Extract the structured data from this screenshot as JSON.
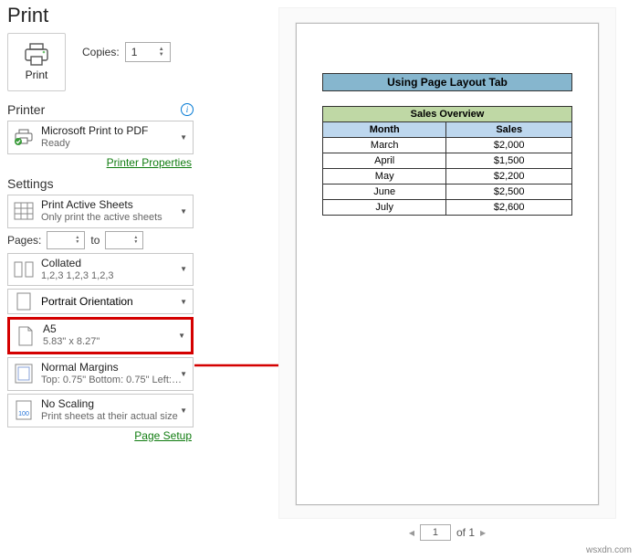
{
  "header": {
    "title": "Print"
  },
  "printButton": {
    "label": "Print"
  },
  "copies": {
    "label": "Copies:",
    "value": "1"
  },
  "printer": {
    "heading": "Printer",
    "name": "Microsoft Print to PDF",
    "status": "Ready",
    "propsLink": "Printer Properties"
  },
  "settings": {
    "heading": "Settings",
    "active": {
      "primary": "Print Active Sheets",
      "secondary": "Only print the active sheets"
    },
    "pagesLabel": "Pages:",
    "toLabel": "to",
    "collated": {
      "primary": "Collated",
      "secondary": "1,2,3   1,2,3   1,2,3"
    },
    "orientation": {
      "primary": "Portrait Orientation"
    },
    "paper": {
      "primary": "A5",
      "secondary": "5.83\" x 8.27\""
    },
    "margins": {
      "primary": "Normal Margins",
      "secondary": "Top: 0.75\" Bottom: 0.75\" Left:…"
    },
    "scaling": {
      "primary": "No Scaling",
      "secondary": "Print sheets at their actual size"
    },
    "pageSetupLink": "Page Setup"
  },
  "preview": {
    "title": "Using Page Layout Tab",
    "tableTitle": "Sales Overview",
    "colMonth": "Month",
    "colSales": "Sales",
    "rows": [
      {
        "month": "March",
        "sales": "$2,000"
      },
      {
        "month": "April",
        "sales": "$1,500"
      },
      {
        "month": "May",
        "sales": "$2,200"
      },
      {
        "month": "June",
        "sales": "$2,500"
      },
      {
        "month": "July",
        "sales": "$2,600"
      }
    ]
  },
  "pager": {
    "current": "1",
    "ofLabel": "of 1"
  },
  "watermark": "wsxdn.com"
}
